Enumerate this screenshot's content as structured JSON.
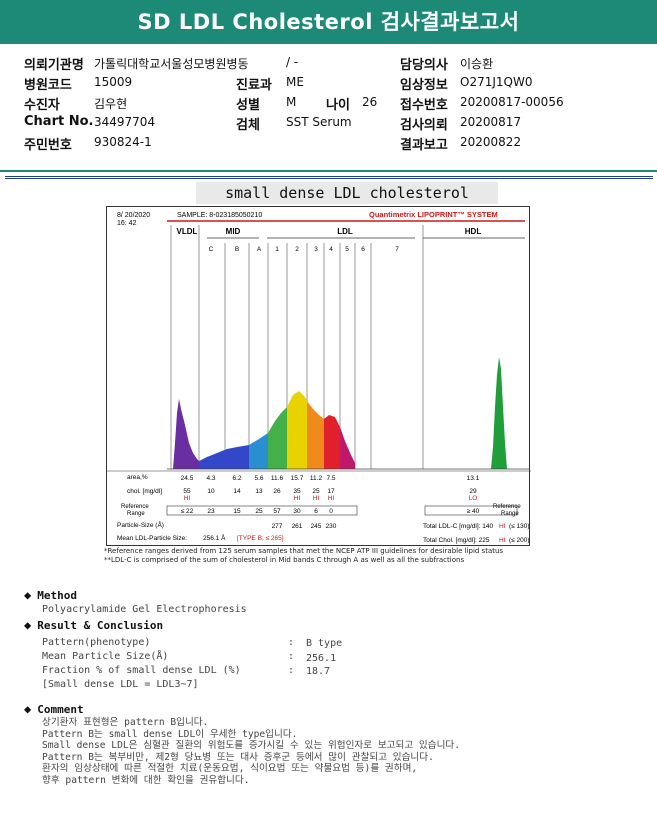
{
  "header": {
    "title": "SD LDL Cholesterol 검사결과보고서"
  },
  "info": {
    "institution_label": "의뢰기관명",
    "institution_value": "가톨릭대학교서울성모병원병동",
    "ward_value": "/ -",
    "physician_label": "담당의사",
    "physician_value": "이승환",
    "hospital_code_label": "병원코드",
    "hospital_code_value": "15009",
    "dept_label": "진료과",
    "dept_value": "ME",
    "clinical_label": "임상정보",
    "clinical_value": "O271J1QW0",
    "patient_label": "수진자",
    "patient_value": "김우현",
    "sex_label": "성별",
    "sex_value": "M",
    "age_label": "나이",
    "age_value": "26",
    "receipt_label": "접수번호",
    "receipt_value": "20200817-00056",
    "chart_label": "Chart No.",
    "chart_value": "34497704",
    "specimen_label": "검체",
    "specimen_value": "SST Serum",
    "request_label": "검사의뢰",
    "request_value": "20200817",
    "rrn_label": "주민번호",
    "rrn_value": "930824-1",
    "report_label": "결과보고",
    "report_value": "20200822"
  },
  "report": {
    "title": "small dense LDL cholesterol",
    "date": "8/ 20/2020",
    "time": "16: 42",
    "sample": "SAMPLE:    8-023185050210",
    "brand": "Quantimetrix LIPOPRINT™ SYSTEM",
    "band_groups": [
      "VLDL",
      "MID",
      "LDL",
      "HDL"
    ],
    "mid_bands": [
      "C",
      "B",
      "A"
    ],
    "ldl_bands": [
      "1",
      "2",
      "3",
      "4",
      "5",
      "6",
      "7"
    ],
    "row_labels": {
      "area": "area,%",
      "chol": "chol. [mg/dl]",
      "ref": "Reference\nRange",
      "size": "Particle-Size (Å)",
      "mean": "Mean LDL-Particle Size:",
      "ref_right": "Reference\nRange"
    },
    "area_values": [
      "24.5",
      "4.3",
      "6.2",
      "5.6",
      "11.6",
      "15.7",
      "11.2",
      "7.5",
      "13.1"
    ],
    "chol_values": [
      "55",
      "10",
      "14",
      "13",
      "26",
      "35",
      "25",
      "17",
      "29"
    ],
    "flags": [
      "HI",
      "HI",
      "HI",
      "HI",
      "LO"
    ],
    "ref_values": [
      "≤ 22",
      "23",
      "15",
      "25",
      "57",
      "30",
      "6",
      "0",
      "≥ 40"
    ],
    "size_values": [
      "277",
      "261",
      "245",
      "230"
    ],
    "mean_size": "256.1 Å",
    "type_label": "[TYPE B; ≤ 265]",
    "total_ldl": "Total LDL-C [mg/dl]:  140",
    "total_ldl_ref": "(≤ 130)",
    "total_chol": "Total Chol. [mg/dl]:  225",
    "total_chol_ref": "(≤ 200)",
    "hi_flag": "HI",
    "notes": [
      "*Reference ranges derived from 125 serum samples that met the NCEP ATP III guidelines for desirable lipid status",
      "**LDL-C is comprised of the sum of cholesterol in Mid bands C through A as well as all the subfractions"
    ]
  },
  "chart_data": {
    "type": "area",
    "title": "",
    "series": [
      {
        "name": "VLDL",
        "color": "#6a2ea3"
      },
      {
        "name": "MID",
        "color": "#3a4bd0"
      },
      {
        "name": "LDL",
        "color": "#f0d000"
      },
      {
        "name": "HDL",
        "color": "#1f9e3a"
      }
    ],
    "bands": [
      "VLDL",
      "C",
      "B",
      "A",
      "1",
      "2",
      "3",
      "4",
      "5",
      "6",
      "7",
      "HDL"
    ],
    "area_percent": [
      24.5,
      4.3,
      6.2,
      5.6,
      11.6,
      15.7,
      11.2,
      7.5,
      0,
      0,
      0,
      13.1
    ],
    "cholesterol_mg_dl": [
      55,
      10,
      14,
      13,
      26,
      35,
      25,
      17,
      0,
      0,
      0,
      29
    ]
  },
  "method": {
    "heading": "Method",
    "text": "Polyacrylamide Gel Electrophoresis"
  },
  "result": {
    "heading": "Result & Conclusion",
    "rows": [
      {
        "label": "Pattern(phenotype)",
        "value": "B type"
      },
      {
        "label": "Mean Particle Size(Å)",
        "value": "256.1"
      },
      {
        "label": "Fraction % of small dense LDL (%)",
        "value": "18.7"
      }
    ],
    "note": "[Small dense LDL = LDL3~7]",
    "colon": ":"
  },
  "comment": {
    "heading": "Comment",
    "lines": [
      "상기환자 표현형은 pattern B입니다.",
      "Pattern B는 small dense LDL이 우세한 type입니다.",
      "Small dense LDL은 심혈관 질환의 위험도를 증가시킬 수 있는 위험인자로 보고되고 있습니다.",
      "Pattern B는 복부비만, 제2형 당뇨병 또는 대사 증후군 등에서 많이 관찰되고 있습니다.",
      "환자의 임상상태에 따른 적절한 치료(운동요법, 식이요법 또는 약물요법 등)를 권하며,",
      "향후 pattern 변화에 대한 확인을 권유합니다."
    ]
  }
}
